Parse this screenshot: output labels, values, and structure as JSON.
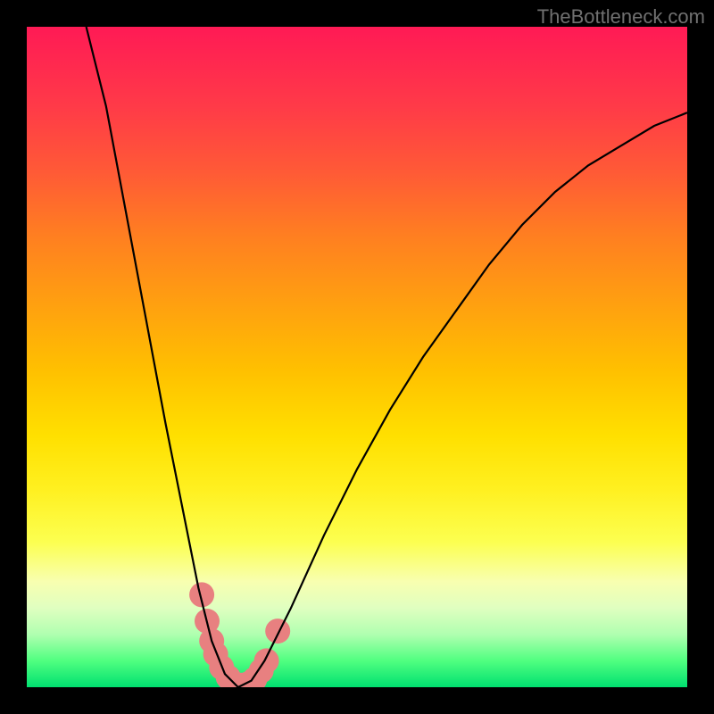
{
  "watermark": "TheBottleneck.com",
  "chart_data": {
    "type": "line",
    "title": "",
    "xlabel": "",
    "ylabel": "",
    "xlim": [
      0,
      100
    ],
    "ylim": [
      0,
      100
    ],
    "curve": {
      "minimum_x": 32,
      "points": [
        {
          "x": 9,
          "y": 100
        },
        {
          "x": 12,
          "y": 88
        },
        {
          "x": 15,
          "y": 72
        },
        {
          "x": 18,
          "y": 56
        },
        {
          "x": 21,
          "y": 40
        },
        {
          "x": 24,
          "y": 25
        },
        {
          "x": 26,
          "y": 15
        },
        {
          "x": 28,
          "y": 7
        },
        {
          "x": 30,
          "y": 2
        },
        {
          "x": 32,
          "y": 0
        },
        {
          "x": 34,
          "y": 1
        },
        {
          "x": 36,
          "y": 4
        },
        {
          "x": 40,
          "y": 12
        },
        {
          "x": 45,
          "y": 23
        },
        {
          "x": 50,
          "y": 33
        },
        {
          "x": 55,
          "y": 42
        },
        {
          "x": 60,
          "y": 50
        },
        {
          "x": 65,
          "y": 57
        },
        {
          "x": 70,
          "y": 64
        },
        {
          "x": 75,
          "y": 70
        },
        {
          "x": 80,
          "y": 75
        },
        {
          "x": 85,
          "y": 79
        },
        {
          "x": 90,
          "y": 82
        },
        {
          "x": 95,
          "y": 85
        },
        {
          "x": 100,
          "y": 87
        }
      ]
    },
    "markers": [
      {
        "x": 26.5,
        "y": 14
      },
      {
        "x": 27.3,
        "y": 10
      },
      {
        "x": 28.0,
        "y": 7
      },
      {
        "x": 28.6,
        "y": 5
      },
      {
        "x": 29.5,
        "y": 3
      },
      {
        "x": 30.5,
        "y": 1.5
      },
      {
        "x": 31.5,
        "y": 0.5
      },
      {
        "x": 32.5,
        "y": 0.3
      },
      {
        "x": 33.5,
        "y": 0.5
      },
      {
        "x": 34.5,
        "y": 1.2
      },
      {
        "x": 35.5,
        "y": 2.5
      },
      {
        "x": 36.3,
        "y": 4.0
      },
      {
        "x": 38.0,
        "y": 8.5
      }
    ],
    "marker_style": {
      "color": "#e88080",
      "radius": 14
    },
    "background_gradient": {
      "top": "#ff1a55",
      "mid": "#ffd000",
      "bottom": "#00e070"
    }
  }
}
